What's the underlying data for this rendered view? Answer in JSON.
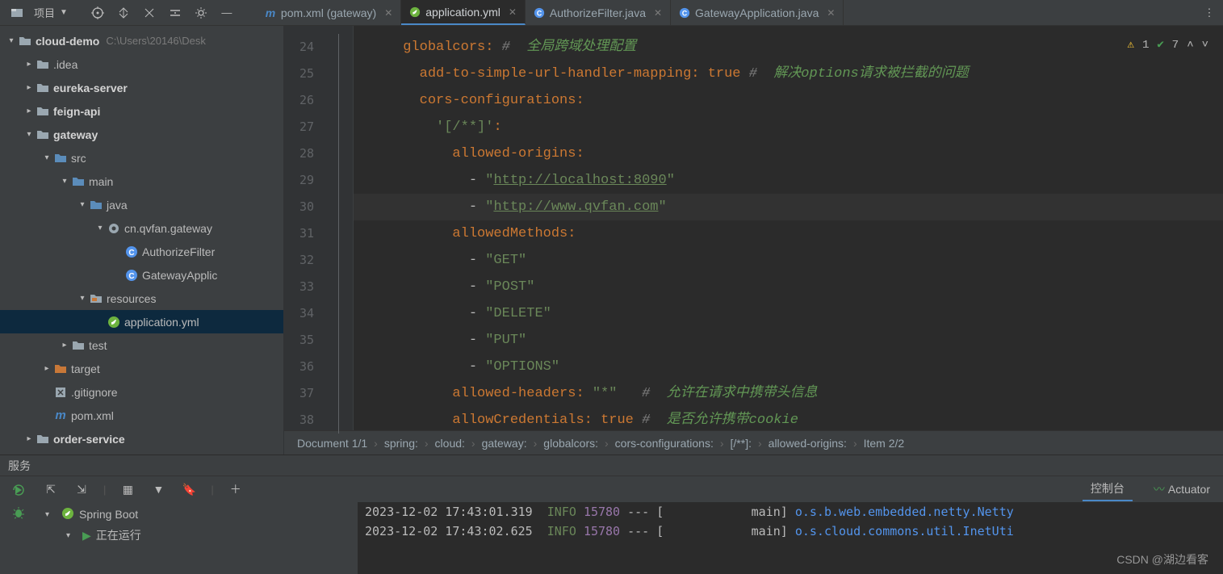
{
  "toolbar": {
    "project_label": "项目",
    "project_root": "cloud-demo",
    "project_path": "C:\\Users\\20146\\Desk"
  },
  "tabs": [
    {
      "label": "pom.xml (gateway)",
      "icon": "m",
      "active": false
    },
    {
      "label": "application.yml",
      "icon": "yml",
      "active": true
    },
    {
      "label": "AuthorizeFilter.java",
      "icon": "java",
      "active": false
    },
    {
      "label": "GatewayApplication.java",
      "icon": "java",
      "active": false
    }
  ],
  "tree": {
    "root": {
      "name": "cloud-demo",
      "path": "C:\\Users\\20146\\Desk"
    },
    "items": [
      {
        "depth": 1,
        "chev": "right",
        "icon": "folder",
        "name": ".idea"
      },
      {
        "depth": 1,
        "chev": "right",
        "icon": "folder",
        "name": "eureka-server",
        "bold": true
      },
      {
        "depth": 1,
        "chev": "right",
        "icon": "folder",
        "name": "feign-api",
        "bold": true
      },
      {
        "depth": 1,
        "chev": "down",
        "icon": "folder",
        "name": "gateway",
        "bold": true
      },
      {
        "depth": 2,
        "chev": "down",
        "icon": "folder-blue",
        "name": "src"
      },
      {
        "depth": 3,
        "chev": "down",
        "icon": "folder-blue",
        "name": "main"
      },
      {
        "depth": 4,
        "chev": "down",
        "icon": "folder-blue",
        "name": "java"
      },
      {
        "depth": 5,
        "chev": "down",
        "icon": "pkg",
        "name": "cn.qvfan.gateway"
      },
      {
        "depth": 6,
        "chev": "none",
        "icon": "java-c",
        "name": "AuthorizeFilter"
      },
      {
        "depth": 6,
        "chev": "none",
        "icon": "java-c",
        "name": "GatewayApplic"
      },
      {
        "depth": 4,
        "chev": "down",
        "icon": "folder-res",
        "name": "resources"
      },
      {
        "depth": 5,
        "chev": "none",
        "icon": "yml",
        "name": "application.yml",
        "selected": true
      },
      {
        "depth": 3,
        "chev": "right",
        "icon": "folder",
        "name": "test"
      },
      {
        "depth": 2,
        "chev": "right",
        "icon": "folder-orange",
        "name": "target"
      },
      {
        "depth": 2,
        "chev": "none",
        "icon": "gitignore",
        "name": ".gitignore"
      },
      {
        "depth": 2,
        "chev": "none",
        "icon": "m",
        "name": "pom.xml"
      },
      {
        "depth": 1,
        "chev": "right",
        "icon": "folder",
        "name": "order-service",
        "bold": true
      }
    ]
  },
  "editor": {
    "lines": [
      {
        "n": 24,
        "html": "      <span class='k-key'>globalcors</span><span class='k-colon'>:</span> <span class='k-comm'>#</span>  <span class='k-commcn'>全局跨域处理配置</span>"
      },
      {
        "n": 25,
        "html": "        <span class='k-key'>add-to-simple-url-handler-mapping</span><span class='k-colon'>:</span> <span class='k-val'>true</span> <span class='k-comm'>#</span>  <span class='k-commcn'>解决options请求被拦截的问题</span>"
      },
      {
        "n": 26,
        "html": "        <span class='k-key'>cors-configurations</span><span class='k-colon'>:</span>"
      },
      {
        "n": 27,
        "html": "          <span class='k-str'>'[/**]'</span><span class='k-colon'>:</span>"
      },
      {
        "n": 28,
        "html": "            <span class='k-key'>allowed-origins</span><span class='k-colon'>:</span>"
      },
      {
        "n": 29,
        "html": "              - <span class='k-str'>\"</span><span class='k-url'>http://localhost:8090</span><span class='k-str'>\"</span>"
      },
      {
        "n": 30,
        "html": "              - <span class='k-str'>\"</span><span class='k-url'>http://www.qvfan.com</span><span class='k-str'>\"</span>",
        "current": true
      },
      {
        "n": 31,
        "html": "            <span class='k-key'>allowedMethods</span><span class='k-colon'>:</span>"
      },
      {
        "n": 32,
        "html": "              - <span class='k-str'>\"GET\"</span>"
      },
      {
        "n": 33,
        "html": "              - <span class='k-str'>\"POST\"</span>"
      },
      {
        "n": 34,
        "html": "              - <span class='k-str'>\"DELETE\"</span>"
      },
      {
        "n": 35,
        "html": "              - <span class='k-str'>\"PUT\"</span>"
      },
      {
        "n": 36,
        "html": "              - <span class='k-str'>\"OPTIONS\"</span>"
      },
      {
        "n": 37,
        "html": "            <span class='k-key'>allowed-headers</span><span class='k-colon'>:</span> <span class='k-str'>\"*\"</span>   <span class='k-comm'>#</span>  <span class='k-commcn'>允许在请求中携带头信息</span>"
      },
      {
        "n": 38,
        "html": "            <span class='k-key'>allowCredentials</span><span class='k-colon'>:</span> <span class='k-val'>true</span> <span class='k-comm'>#</span>  <span class='k-commcn'>是否允许携带cookie</span>"
      }
    ],
    "indicators": {
      "warnings": "1",
      "checks": "7"
    }
  },
  "breadcrumbs": [
    "Document 1/1",
    "spring:",
    "cloud:",
    "gateway:",
    "globalcors:",
    "cors-configurations:",
    "[/**]:",
    "allowed-origins:",
    "Item 2/2"
  ],
  "services": {
    "title": "服务",
    "tabs": {
      "console": "控制台",
      "actuator": "Actuator"
    },
    "tree": {
      "root": "Spring Boot",
      "child": "正在运行"
    },
    "logs": [
      {
        "ts": "2023-12-02 17:43:01.319",
        "lvl": "INFO",
        "pid": "15780",
        "sep": "---",
        "thread": "[            main]",
        "cls": "o.s.b.web.embedded.netty.Netty"
      },
      {
        "ts": "2023-12-02 17:43:02.625",
        "lvl": "INFO",
        "pid": "15780",
        "sep": "---",
        "thread": "[            main]",
        "cls": "o.s.cloud.commons.util.InetUti"
      }
    ]
  },
  "watermark": "CSDN @湖边看客"
}
